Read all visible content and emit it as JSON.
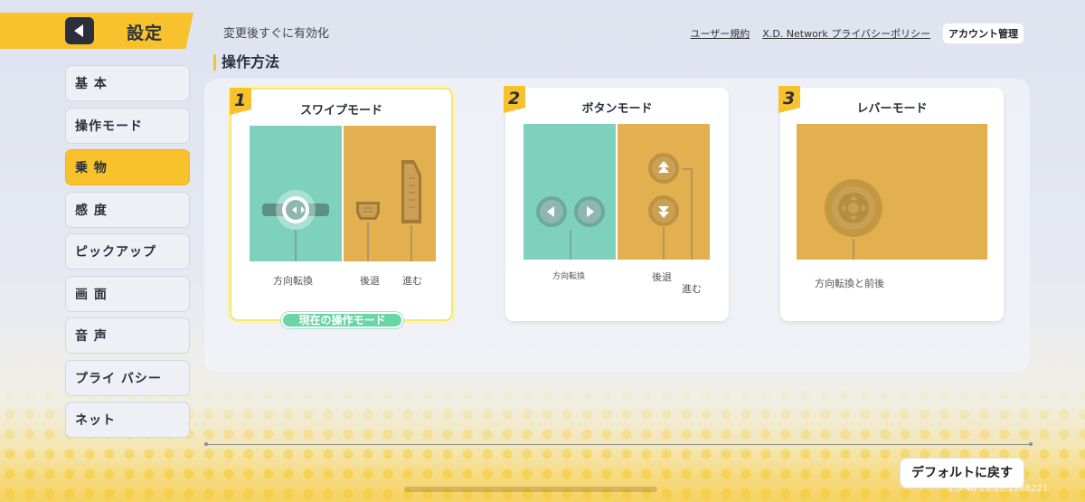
{
  "header": {
    "title": "設定",
    "subtitle": "変更後すぐに有効化",
    "links": [
      "ユーザー規約",
      "X.D. Network プライバシーポリシー"
    ],
    "account_button": "アカウント管理"
  },
  "sidebar": {
    "items": [
      {
        "label": "基 本",
        "active": false
      },
      {
        "label": "操作モード",
        "active": false
      },
      {
        "label": "乗 物",
        "active": true
      },
      {
        "label": "感 度",
        "active": false
      },
      {
        "label": "ピックアップ",
        "active": false
      },
      {
        "label": "画 面",
        "active": false
      },
      {
        "label": "音 声",
        "active": false
      },
      {
        "label": "プライ バシー",
        "active": false
      },
      {
        "label": "ネット",
        "active": false
      }
    ]
  },
  "section": {
    "title": "操作方法",
    "cards": [
      {
        "number": "1",
        "title": "スワイプモード",
        "labels": {
          "steer": "方向転換",
          "back": "後退",
          "forward": "進む"
        },
        "selected": true,
        "badge": "現在の操作モード"
      },
      {
        "number": "2",
        "title": "ボタンモード",
        "labels": {
          "steer": "方向転換",
          "back": "後退",
          "forward": "進む"
        },
        "selected": false
      },
      {
        "number": "3",
        "title": "レバーモード",
        "labels": {
          "steer": "方向転換と前後"
        },
        "selected": false
      }
    ]
  },
  "footer": {
    "default_button": "デフォルトに戻す",
    "version": "1.5.48 15.13.1266221"
  },
  "colors": {
    "accent": "#f8c22c",
    "teal": "#7ed2bd",
    "gold": "#e2b04f",
    "badge": "#6cd5a8"
  }
}
